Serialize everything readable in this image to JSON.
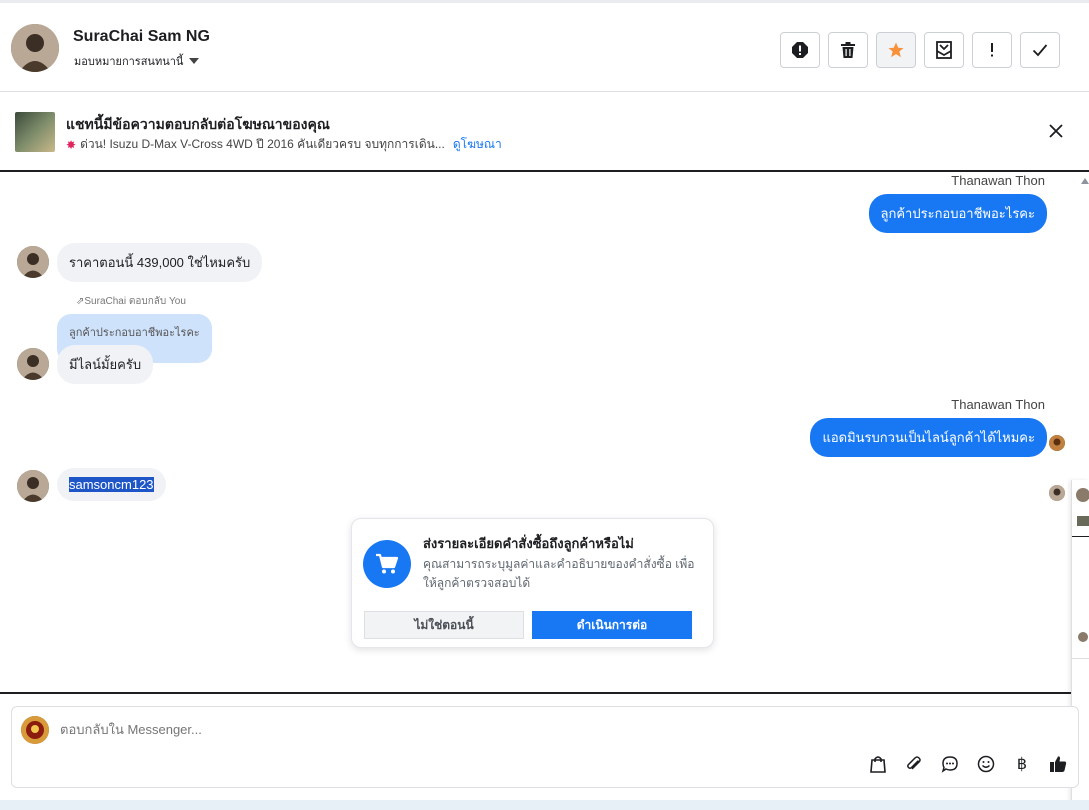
{
  "header": {
    "name": "SuraChai Sam NG",
    "assign_label": "มอบหมายการสนทนานี้",
    "actions": [
      "spam-icon",
      "trash-icon",
      "star-icon",
      "archive-mail-icon",
      "exclamation-icon",
      "check-icon"
    ]
  },
  "ad_banner": {
    "title": "แชทนี้มีข้อความตอบกลับต่อโฆษณาของคุณ",
    "description": "ด่วน! Isuzu D-Max V-Cross 4WD ปี 2016 คันเดียวครบ จบทุกการเดิน...",
    "link": "ดูโฆษณา"
  },
  "messages": {
    "m1_sender": "Thanawan Thon",
    "m1_text": "ลูกค้าประกอบอาชีพอะไรคะ",
    "m2_text": "ราคาตอนนี้ 439,000 ใช่ไหมครับ",
    "m3_reply_note": "SuraChai ตอบกลับ You",
    "m3_quoted": "ลูกค้าประกอบอาชีพอะไรคะ",
    "m3_text": "มีไลน์มั้ยครับ",
    "m4_sender": "Thanawan Thon",
    "m4_text": "แอดมินรบกวนเป็นไลน์ลูกค้าได้ไหมคะ",
    "m5_text": "samsoncm123"
  },
  "order_card": {
    "title": "ส่งรายละเอียดคำสั่งซื้อถึงลูกค้าหรือไม่",
    "description": "คุณสามารถระบุมูลค่าและคำอธิบายของคำสั่งซื้อ เพื่อให้ลูกค้าตรวจสอบได้",
    "secondary_button": "ไม่ใช่ตอนนี้",
    "primary_button": "ดำเนินการต่อ"
  },
  "composer": {
    "placeholder": "ตอบกลับใน Messenger...",
    "tools": [
      "shopping-bag-icon",
      "paperclip-icon",
      "chat-bubble-icon",
      "emoji-icon",
      "baht-icon",
      "thumbs-up-icon"
    ]
  },
  "colors": {
    "accent": "#1877f2",
    "bubble_in": "#f0f2f5",
    "quoted": "#cfe2fb",
    "star": "#f7923a"
  }
}
